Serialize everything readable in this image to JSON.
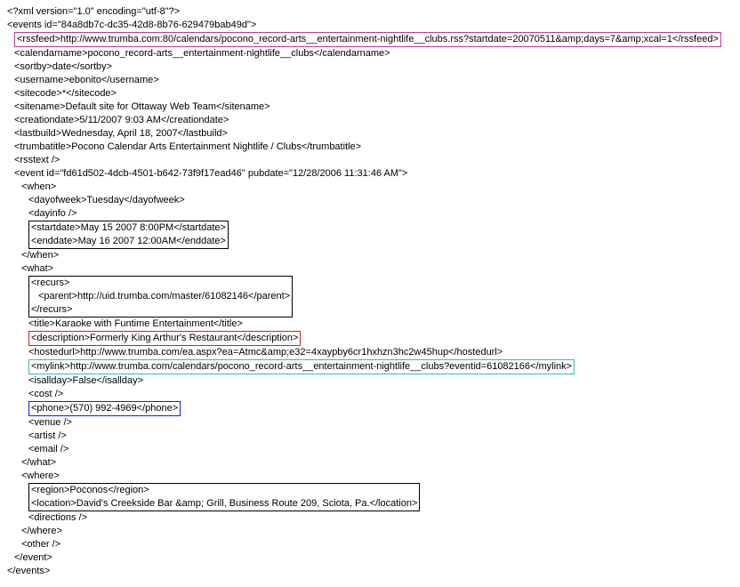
{
  "xml_decl": "<?xml version=\"1.0\" encoding=\"utf-8\"?>",
  "events_open": "<events id=\"84a8db7c-dc35-42d8-8b76-629479bab49d\">",
  "rssfeed": "<rssfeed>http://www.trumba.com:80/calendars/pocono_record-arts__entertainment-nightlife__clubs.rss?startdate=20070511&amp;days=7&amp;xcal=1</rssfeed>",
  "calendarname": "<calendarname>pocono_record-arts__entertainment-nightlife__clubs</calendarname>",
  "sortby": "<sortby>date</sortby>",
  "username": "<username>ebonito</username>",
  "sitecode": "<sitecode>*</sitecode>",
  "sitename": "<sitename>Default site for Ottaway Web Team</sitename>",
  "creationdate": "<creationdate>5/11/2007 9:03 AM</creationdate>",
  "lastbuild": "<lastbuild>Wednesday, April 18, 2007</lastbuild>",
  "trumbatitle": "<trumbatitle>Pocono Calendar Arts Entertainment Nightlife / Clubs</trumbatitle>",
  "rsstext": "<rsstext />",
  "event_open": "<event id=\"fd61d502-4dcb-4501-b642-73f9f17ead46\" pubdate=\"12/28/2006 11:31:46 AM\">",
  "when_open": "<when>",
  "dayofweek": "<dayofweek>Tuesday</dayofweek>",
  "dayinfo": "<dayinfo />",
  "startdate": "<startdate>May 15 2007 8:00PM</startdate>",
  "enddate": "<enddate>May 16 2007 12:00AM</enddate>",
  "when_close": "</when>",
  "what_open": "<what>",
  "recurs_open": "<recurs>",
  "parent": "<parent>http://uid.trumba.com/master/61082146</parent>",
  "recurs_close": "</recurs>",
  "title": "<title>Karaoke with Funtime Entertainment</title>",
  "description": "<description>Formerly King Arthur's Restaurant</description>",
  "hostedurl": "<hostedurl>http://www.trumba.com/ea.aspx?ea=Atmc&amp;e32=4xaypby6cr1hxhzn3hc2w45hup</hostedurl>",
  "mylink": "<mylink>http://www.trumba.com/calendars/pocono_record-arts__entertainment-nightlife__clubs?eventid=61082166</mylink>",
  "isallday": "<isallday>False</isallday>",
  "cost": "<cost />",
  "phone": "<phone>(570) 992-4969</phone>",
  "venue": "<venue />",
  "artist": "<artist />",
  "email": "<email />",
  "what_close": "</what>",
  "where_open": "<where>",
  "region": "<region>Poconos</region>",
  "location": "<location>David's Creekside Bar &amp; Grill, Business Route 209, Sciota, Pa.</location>",
  "directions": "<directions />",
  "where_close": "</where>",
  "other": "<other />",
  "event_close": "</event>",
  "events_close": "</events>"
}
